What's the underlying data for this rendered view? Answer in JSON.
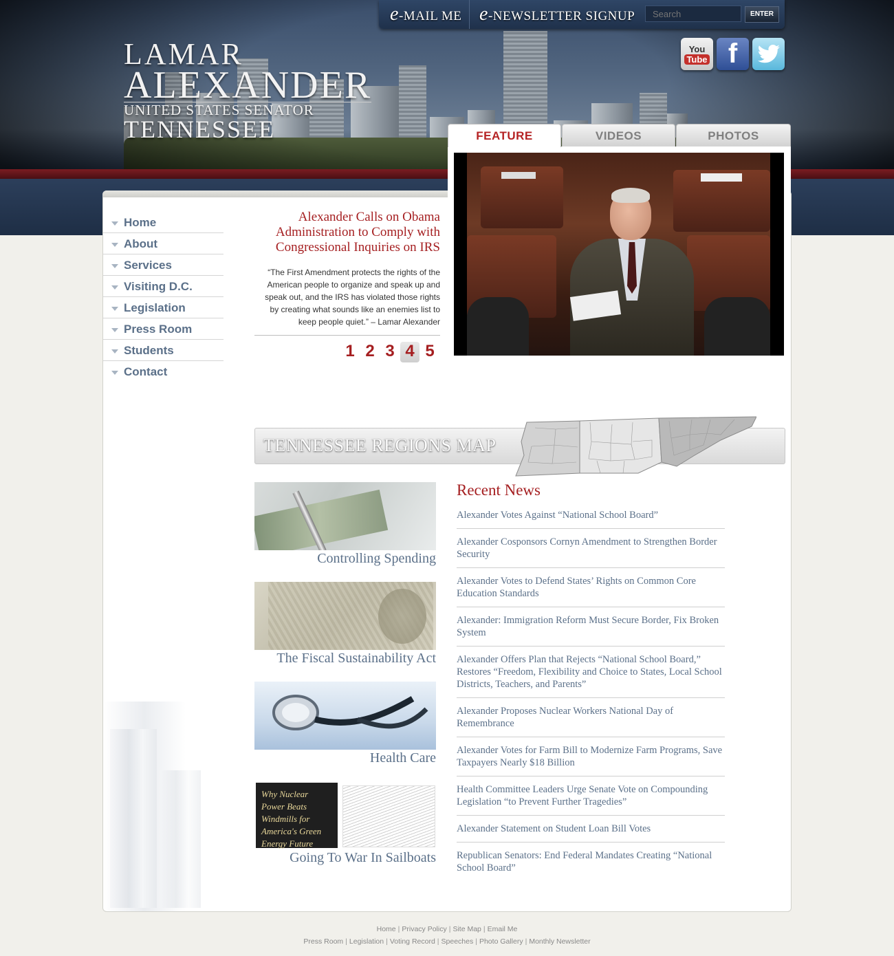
{
  "header": {
    "logo_line1": "LAMAR",
    "logo_line2": "ALEXANDER",
    "logo_line3": "UNITED STATES SENATOR",
    "logo_line4": "TENNESSEE",
    "email_prefix": "e",
    "email_label": "-MAIL ME",
    "newsletter_prefix": "e",
    "newsletter_label": "-NEWSLETTER SIGNUP",
    "search_placeholder": "Search",
    "search_button": "ENTER",
    "social": {
      "youtube_top": "You",
      "youtube_bottom": "Tube",
      "facebook": "f"
    }
  },
  "sidebar": {
    "items": [
      {
        "label": "Home"
      },
      {
        "label": "About"
      },
      {
        "label": "Services"
      },
      {
        "label": "Visiting D.C."
      },
      {
        "label": "Legislation"
      },
      {
        "label": "Press Room"
      },
      {
        "label": "Students"
      },
      {
        "label": "Contact"
      }
    ]
  },
  "feature": {
    "tabs": [
      {
        "label": "FEATURE",
        "active": true
      },
      {
        "label": "VIDEOS",
        "active": false
      },
      {
        "label": "PHOTOS",
        "active": false
      }
    ],
    "headline": "Alexander Calls on Obama Administration to Comply with Congressional Inquiries on IRS",
    "quote": "“The First Amendment protects the rights of the American people to organize and speak up and speak out, and the IRS has violated those rights by creating what sounds like an enemies list to keep people quiet.” – Lamar Alexander",
    "pages": [
      "1",
      "2",
      "3",
      "4",
      "5"
    ],
    "current_page": "4"
  },
  "regions_map": {
    "title": "TENNESSEE REGIONS MAP"
  },
  "issues": [
    {
      "caption": "Controlling Spending"
    },
    {
      "caption": "The Fiscal Sustainability Act"
    },
    {
      "caption": "Health Care"
    },
    {
      "caption": "Going To War In Sailboats",
      "image_text": "Why Nuclear Power Beats Windmills for America's Green Energy Future"
    }
  ],
  "recent_news": {
    "title": "Recent News",
    "items": [
      "Alexander Votes Against “National School Board”",
      "Alexander Cosponsors Cornyn Amendment to Strengthen Border Security",
      "Alexander Votes to Defend States’ Rights on Common Core Education Standards",
      "Alexander: Immigration Reform Must Secure Border, Fix Broken System",
      "Alexander Offers Plan that Rejects “National School Board,” Restores “Freedom, Flexibility and Choice to States, Local School Districts, Teachers, and Parents”",
      "Alexander Proposes Nuclear Workers National Day of Remembrance",
      "Alexander Votes for Farm Bill to Modernize Farm Programs, Save Taxpayers Nearly $18 Billion",
      "Health Committee Leaders Urge Senate Vote on Compounding Legislation “to Prevent Further Tragedies”",
      "Alexander Statement on Student Loan Bill Votes",
      "Republican Senators: End Federal Mandates Creating “National School Board”"
    ]
  },
  "footer": {
    "row1": [
      "Home",
      "Privacy Policy",
      "Site Map",
      "Email Me"
    ],
    "row2": [
      "Press Room",
      "Legislation",
      "Voting Record",
      "Speeches",
      "Photo Gallery",
      "Monthly Newsletter"
    ]
  },
  "colors": {
    "accent_red": "#a51f21",
    "link_blue": "#5b7089",
    "header_navy": "#1f314b"
  }
}
